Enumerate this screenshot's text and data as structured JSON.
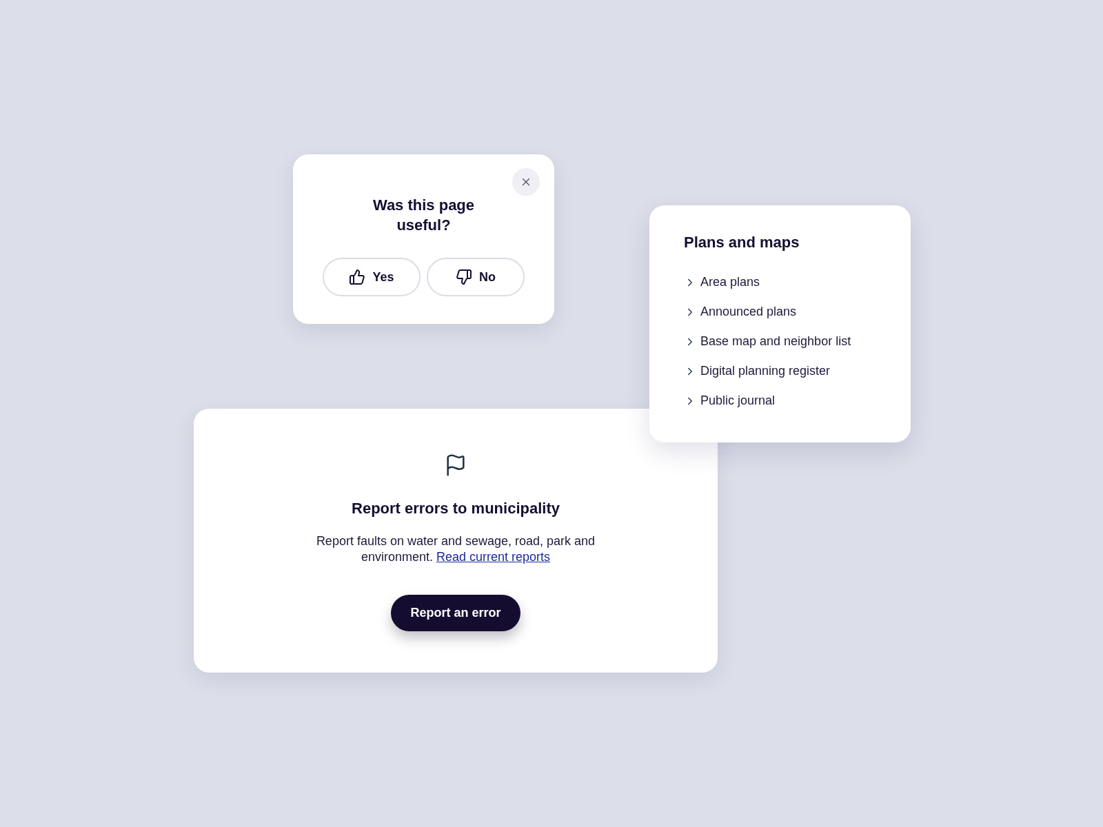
{
  "feedback_card": {
    "title": "Was this page useful?",
    "buttons": [
      {
        "kind": "thumbs_up",
        "label": "Yes"
      },
      {
        "kind": "thumbs_down",
        "label": "No"
      }
    ]
  },
  "plans_card": {
    "title": "Plans and maps",
    "links": [
      "Area plans",
      "Announced plans",
      "Base map and neighbor list",
      "Digital planning register",
      "Public journal"
    ]
  },
  "report_card": {
    "title": "Report errors to municipality",
    "text": "Report faults on water and sewage, road, park and environment.",
    "link": "Read current reports",
    "button": "Report an error"
  }
}
